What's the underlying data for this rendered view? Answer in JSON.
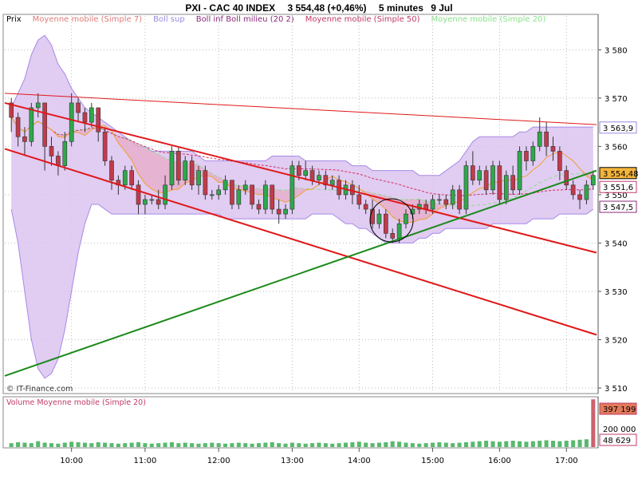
{
  "header": {
    "title": "PXI - CAC 40 INDEX",
    "price": "3 554,48 (+0,46%)",
    "interval": "5 minutes",
    "date": "9 Jul"
  },
  "legend": [
    {
      "label": "Prix",
      "color": "#000000"
    },
    {
      "label": "Moyenne mobile (Simple 7)",
      "color": "#e07a7a"
    },
    {
      "label": "Boll sup",
      "color": "#9a8ae0"
    },
    {
      "label": "Boll inf Boll milieu (20 2)",
      "color": "#8a2a7a"
    },
    {
      "label": "Moyenne mobile (Simple 50)",
      "color": "#c03a6a"
    },
    {
      "label": "Moyenne mobile (Simple 20)",
      "color": "#8ae08a"
    }
  ],
  "watermark": "© IT-Finance.com",
  "volume_legend": "Volume Moyenne mobile (Simple 20)",
  "colors": {
    "up": "#2ea84a",
    "down": "#c23a4a",
    "boll_fill": "#dcc3f0",
    "boll_line": "#a58ae6",
    "pink_fill": "#e8a8c4",
    "trend_red": "#e01818",
    "trend_green": "#1a8a1a",
    "sma7": "#f0a030",
    "sma50": "#d23060",
    "sma20": "#8ae08a"
  },
  "chart_data": {
    "type": "candlestick",
    "xlabel": "",
    "ylabel": "",
    "ylim": [
      3509,
      3587
    ],
    "y_ticks": [
      "3 510",
      "3 520",
      "3 530",
      "3 540",
      "3 550",
      "3 560",
      "3 570",
      "3 580"
    ],
    "x_ticks": [
      "10:00",
      "11:00",
      "12:00",
      "13:00",
      "14:00",
      "15:00",
      "16:00",
      "17:00"
    ],
    "price_labels": [
      {
        "value": 3563.9,
        "text": "3 563,9",
        "color": "#9a8ae0",
        "fill": "#ffffff"
      },
      {
        "value": 3554.48,
        "text": "3 554,48",
        "color": "#000000",
        "fill": "#f4b43c"
      },
      {
        "value": 3551.6,
        "text": "3 551,6",
        "color": "#c03a6a",
        "fill": "#ffffff"
      },
      {
        "value": 3547.5,
        "text": "3 547,5",
        "color": "#8a2a7a",
        "fill": "#ffffff"
      }
    ],
    "volume_ticks": [
      "200 000"
    ],
    "volume_labels": [
      {
        "text": "397 199",
        "fill": "#e27a5a"
      },
      {
        "text": "48 629",
        "fill": "#ffffff"
      }
    ],
    "candles": [
      [
        3569,
        3570,
        3563,
        3566
      ],
      [
        3566,
        3567,
        3560,
        3562
      ],
      [
        3562,
        3564,
        3558,
        3561
      ],
      [
        3561,
        3569,
        3560,
        3568
      ],
      [
        3568,
        3571,
        3566,
        3569
      ],
      [
        3569,
        3569,
        3555,
        3560
      ],
      [
        3560,
        3562,
        3556,
        3558
      ],
      [
        3558,
        3559,
        3554,
        3556
      ],
      [
        3556,
        3563,
        3555,
        3561
      ],
      [
        3561,
        3571,
        3560,
        3569
      ],
      [
        3569,
        3570,
        3565,
        3567
      ],
      [
        3567,
        3568,
        3563,
        3565
      ],
      [
        3565,
        3569,
        3564,
        3568
      ],
      [
        3568,
        3568,
        3561,
        3563
      ],
      [
        3563,
        3564,
        3556,
        3557
      ],
      [
        3557,
        3558,
        3551,
        3553
      ],
      [
        3553,
        3554,
        3550,
        3552
      ],
      [
        3552,
        3556,
        3551,
        3555
      ],
      [
        3555,
        3556,
        3551,
        3552
      ],
      [
        3552,
        3553,
        3546,
        3548
      ],
      [
        3548,
        3550,
        3546,
        3549
      ],
      [
        3549,
        3550,
        3548,
        3549
      ],
      [
        3549,
        3551,
        3547,
        3548
      ],
      [
        3548,
        3554,
        3547,
        3552
      ],
      [
        3552,
        3560,
        3551,
        3559
      ],
      [
        3559,
        3560,
        3552,
        3553
      ],
      [
        3553,
        3558,
        3552,
        3557
      ],
      [
        3557,
        3558,
        3551,
        3552
      ],
      [
        3552,
        3556,
        3550,
        3555
      ],
      [
        3555,
        3556,
        3549,
        3550
      ],
      [
        3550,
        3551,
        3549,
        3550
      ],
      [
        3550,
        3552,
        3549,
        3551
      ],
      [
        3551,
        3554,
        3550,
        3553
      ],
      [
        3553,
        3553,
        3547,
        3548
      ],
      [
        3548,
        3552,
        3547,
        3551
      ],
      [
        3551,
        3553,
        3550,
        3552
      ],
      [
        3552,
        3552,
        3547,
        3548
      ],
      [
        3548,
        3549,
        3546,
        3547
      ],
      [
        3547,
        3553,
        3546,
        3552
      ],
      [
        3552,
        3552,
        3546,
        3547
      ],
      [
        3547,
        3549,
        3544,
        3546
      ],
      [
        3546,
        3548,
        3545,
        3547
      ],
      [
        3547,
        3557,
        3546,
        3556
      ],
      [
        3556,
        3557,
        3553,
        3554
      ],
      [
        3554,
        3557,
        3553,
        3555
      ],
      [
        3555,
        3556,
        3552,
        3553
      ],
      [
        3553,
        3555,
        3552,
        3554
      ],
      [
        3554,
        3555,
        3551,
        3552
      ],
      [
        3552,
        3554,
        3551,
        3553
      ],
      [
        3553,
        3554,
        3549,
        3550
      ],
      [
        3550,
        3553,
        3549,
        3552
      ],
      [
        3552,
        3553,
        3548,
        3550
      ],
      [
        3550,
        3552,
        3547,
        3548
      ],
      [
        3548,
        3549,
        3546,
        3547
      ],
      [
        3547,
        3549,
        3543,
        3544
      ],
      [
        3544,
        3547,
        3543,
        3546
      ],
      [
        3546,
        3547,
        3541,
        3542
      ],
      [
        3542,
        3543,
        3540,
        3541
      ],
      [
        3541,
        3545,
        3540,
        3544
      ],
      [
        3544,
        3547,
        3543,
        3546
      ],
      [
        3546,
        3548,
        3545,
        3547
      ],
      [
        3547,
        3549,
        3546,
        3548
      ],
      [
        3548,
        3549,
        3546,
        3547
      ],
      [
        3547,
        3550,
        3546,
        3549
      ],
      [
        3549,
        3550,
        3548,
        3549
      ],
      [
        3549,
        3550,
        3547,
        3548
      ],
      [
        3548,
        3552,
        3547,
        3551
      ],
      [
        3551,
        3552,
        3546,
        3547
      ],
      [
        3547,
        3557,
        3546,
        3556
      ],
      [
        3556,
        3559,
        3552,
        3553
      ],
      [
        3553,
        3556,
        3552,
        3555
      ],
      [
        3555,
        3556,
        3550,
        3551
      ],
      [
        3551,
        3557,
        3550,
        3556
      ],
      [
        3556,
        3557,
        3548,
        3549
      ],
      [
        3549,
        3555,
        3548,
        3554
      ],
      [
        3554,
        3556,
        3550,
        3551
      ],
      [
        3551,
        3560,
        3550,
        3559
      ],
      [
        3559,
        3560,
        3555,
        3557
      ],
      [
        3557,
        3561,
        3556,
        3560
      ],
      [
        3560,
        3566,
        3559,
        3563
      ],
      [
        3563,
        3565,
        3558,
        3560
      ],
      [
        3560,
        3562,
        3557,
        3559
      ],
      [
        3559,
        3560,
        3553,
        3555
      ],
      [
        3555,
        3556,
        3551,
        3552
      ],
      [
        3552,
        3553,
        3549,
        3550
      ],
      [
        3550,
        3551,
        3547,
        3549
      ],
      [
        3549,
        3553,
        3548,
        3552
      ],
      [
        3552,
        3555,
        3551,
        3554
      ]
    ],
    "bollinger": {
      "upper": [
        3568,
        3571,
        3574,
        3579,
        3582,
        3583,
        3581,
        3577,
        3575,
        3572,
        3570,
        3568,
        3567,
        3566,
        3565,
        3564,
        3563,
        3562,
        3561,
        3560,
        3560,
        3559,
        3559,
        3559,
        3559,
        3559,
        3559,
        3559,
        3558,
        3557,
        3557,
        3557,
        3557,
        3557,
        3557,
        3557,
        3557,
        3557,
        3557,
        3558,
        3558,
        3558,
        3558,
        3558,
        3557,
        3557,
        3557,
        3557,
        3557,
        3557,
        3557,
        3556,
        3556,
        3556,
        3555,
        3555,
        3555,
        3555,
        3555,
        3555,
        3555,
        3554,
        3554,
        3554,
        3554,
        3555,
        3556,
        3557,
        3559,
        3561,
        3562,
        3562,
        3562,
        3562,
        3562,
        3562,
        3563,
        3563,
        3564,
        3564,
        3564,
        3564,
        3564,
        3564,
        3564,
        3564,
        3564,
        3564
      ],
      "lower": [
        3547,
        3540,
        3530,
        3520,
        3514,
        3512,
        3513,
        3516,
        3522,
        3530,
        3538,
        3544,
        3548,
        3548,
        3547,
        3546,
        3546,
        3546,
        3546,
        3546,
        3546,
        3546,
        3546,
        3546,
        3546,
        3546,
        3546,
        3546,
        3546,
        3546,
        3546,
        3546,
        3545,
        3545,
        3545,
        3545,
        3545,
        3545,
        3545,
        3545,
        3545,
        3545,
        3545,
        3545,
        3545,
        3546,
        3546,
        3546,
        3546,
        3545,
        3544,
        3544,
        3543,
        3543,
        3542,
        3541,
        3540,
        3540,
        3540,
        3540,
        3540,
        3541,
        3541,
        3542,
        3542,
        3543,
        3543,
        3543,
        3543,
        3543,
        3543,
        3543,
        3544,
        3544,
        3544,
        3544,
        3544,
        3544,
        3545,
        3545,
        3545,
        3545,
        3546,
        3546,
        3546,
        3546,
        3546,
        3547
      ]
    },
    "trend_lines": [
      {
        "color": "red",
        "x1": 0,
        "y1": 3569.0,
        "x2": 1,
        "y2": 3538.0
      },
      {
        "color": "red",
        "x1": 0,
        "y1": 3559.5,
        "x2": 1,
        "y2": 3521.0
      },
      {
        "color": "green",
        "x1": 0,
        "y1": 3512.5,
        "x2": 1,
        "y2": 3555.0
      },
      {
        "color": "thin-red",
        "x1": 0,
        "y1": 3571.0,
        "x2": 1,
        "y2": 3564.5
      }
    ],
    "volumes": [
      8,
      10,
      9,
      8,
      12,
      9,
      8,
      7,
      9,
      11,
      10,
      9,
      8,
      10,
      9,
      8,
      7,
      8,
      9,
      10,
      8,
      7,
      8,
      9,
      10,
      8,
      9,
      8,
      7,
      8,
      9,
      8,
      7,
      8,
      9,
      8,
      7,
      8,
      9,
      10,
      8,
      7,
      9,
      8,
      7,
      8,
      9,
      8,
      7,
      8,
      9,
      10,
      11,
      9,
      8,
      9,
      10,
      12,
      11,
      9,
      8,
      7,
      8,
      9,
      10,
      9,
      8,
      9,
      10,
      11,
      12,
      13,
      12,
      11,
      12,
      13,
      12,
      11,
      12,
      13,
      14,
      13,
      12,
      13,
      14,
      15,
      16,
      98
    ]
  }
}
